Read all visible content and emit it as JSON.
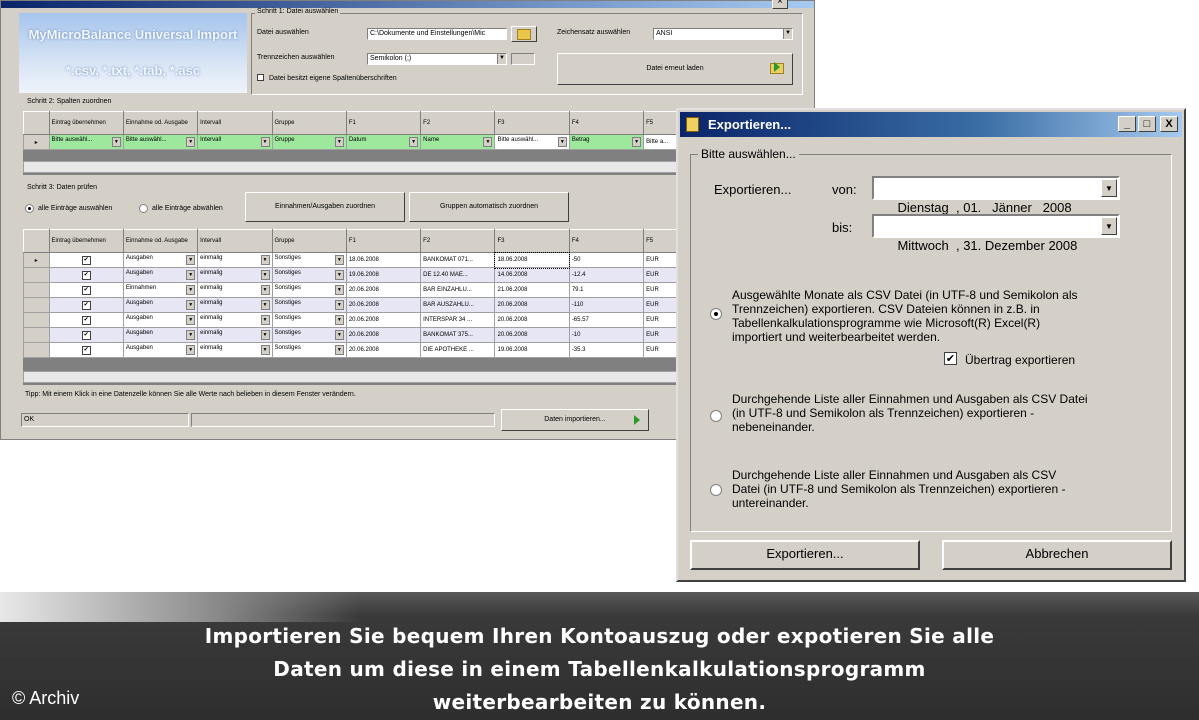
{
  "main_window": {
    "logo_name": "MyMicroBalance Universal Import",
    "logo_ext": "*.csv, *.txt, *.tab, *.asc",
    "step1": {
      "label": "Schritt 1: Datei auswählen",
      "file_label": "Datei auswählen",
      "file_value": "C:\\Dokumente und Einstellungen\\Mic",
      "separator_label": "Trennzeichen auswählen",
      "separator_value": "Semikolon (;)",
      "header_checkbox": "Datei besitzt eigene Spaltenüberschriften",
      "charset_label": "Zeichensatz auswählen",
      "charset_value": "ANSI",
      "reload_button": "Datei erneut laden"
    },
    "step2": {
      "label": "Schritt 2: Spalten zuordnen",
      "headers": [
        "Eintrag übernehmen",
        "Einnahme od. Ausgabe",
        "Intervall",
        "Gruppe",
        "F1",
        "F2",
        "F3",
        "F4",
        "F5"
      ],
      "row": [
        "Bitte auswähl...",
        "Bitte auswähl...",
        "Intervall",
        "Gruppe",
        "Datum",
        "Name",
        "Bitte auswähl...",
        "Betrag",
        "Bitte a..."
      ]
    },
    "step3": {
      "label": "Schritt 3: Daten prüfen",
      "radio_select_all": "alle Einträge auswählen",
      "radio_deselect_all": "alle Einträge abwählen",
      "assign_button": "Einnahmen/Ausgaben zuordnen",
      "groups_button": "Gruppen automatisch zuordnen",
      "headers": [
        "Eintrag übernehmen",
        "Einnahme od. Ausgabe",
        "Intervall",
        "Gruppe",
        "F1",
        "F2",
        "F3",
        "F4",
        "F5"
      ],
      "rows": [
        [
          "Ausgaben",
          "einmalig",
          "Sonstiges",
          "18.06.2008",
          "BANKOMAT 071...",
          "18.06.2008",
          "-50",
          "EUR"
        ],
        [
          "Ausgaben",
          "einmalig",
          "Sonstiges",
          "19.06.2008",
          "DE    12.40 MAE...",
          "14.06.2008",
          "-12.4",
          "EUR"
        ],
        [
          "Einnahmen",
          "einmalig",
          "Sonstiges",
          "20.06.2008",
          "BAR EINZAHLU...",
          "21.06.2008",
          "79.1",
          "EUR"
        ],
        [
          "Ausgaben",
          "einmalig",
          "Sonstiges",
          "20.06.2008",
          "BAR AUSZAHLU...",
          "20.06.2008",
          "-110",
          "EUR"
        ],
        [
          "Ausgaben",
          "einmalig",
          "Sonstiges",
          "20.06.2008",
          "INTERSPAR 34 ...",
          "20.06.2008",
          "-65.57",
          "EUR"
        ],
        [
          "Ausgaben",
          "einmalig",
          "Sonstiges",
          "20.06.2008",
          "BANKOMAT 375...",
          "20.06.2008",
          "-10",
          "EUR"
        ],
        [
          "Ausgaben",
          "einmalig",
          "Sonstiges",
          "20.06.2008",
          "DIE APOTHEKE ...",
          "19.06.2008",
          "-35.3",
          "EUR"
        ]
      ]
    },
    "tip": "Tipp: Mit einem Klick in eine Datenzelle können Sie alle Werte nach belieben in diesem Fenster verändern.",
    "status": "OK",
    "import_button": "Daten importieren..."
  },
  "export_dialog": {
    "title": "Exportieren...",
    "title_buttons": [
      "_",
      "□",
      "X"
    ],
    "group_label": "Bitte auswählen...",
    "export_label": "Exportieren...",
    "from_label": "von:",
    "from_value": "Dienstag  , 01.   Jänner   2008",
    "to_label": "bis:",
    "to_value": "Mittwoch  , 31. Dezember 2008",
    "option1_line1": "Ausgewählte Monate als CSV Datei (in UTF-8 und Semikolon als",
    "option1_line2": "Trennzeichen) exportieren. CSV Dateien können in z.B. in",
    "option1_line3": "Tabellenkalkulationsprogramme wie Microsoft(R) Excel(R)",
    "option1_line4": "importiert und weiterbearbeitet werden.",
    "carry_over_checkbox": "Übertrag exportieren",
    "option2_line1": "Durchgehende Liste aller Einnahmen und Ausgaben als CSV Datei",
    "option2_line2": "(in UTF-8 und Semikolon als Trennzeichen) exportieren -",
    "option2_line3": "nebeneinander.",
    "option3_line1": "Durchgehende Liste aller Einnahmen und Ausgaben als CSV",
    "option3_line2": "Datei  (in UTF-8 und Semikolon als Trennzeichen) exportieren -",
    "option3_line3": "untereinander.",
    "export_button": "Exportieren...",
    "cancel_button": "Abbrechen"
  },
  "caption": {
    "line1": "Importieren Sie bequem Ihren Kontoauszug oder expotieren Sie alle",
    "line2": "Daten um diese in einem Tabellenkalkulationsprogramm",
    "line3": "weiterbearbeiten zu können.",
    "credit": "© Archiv"
  }
}
